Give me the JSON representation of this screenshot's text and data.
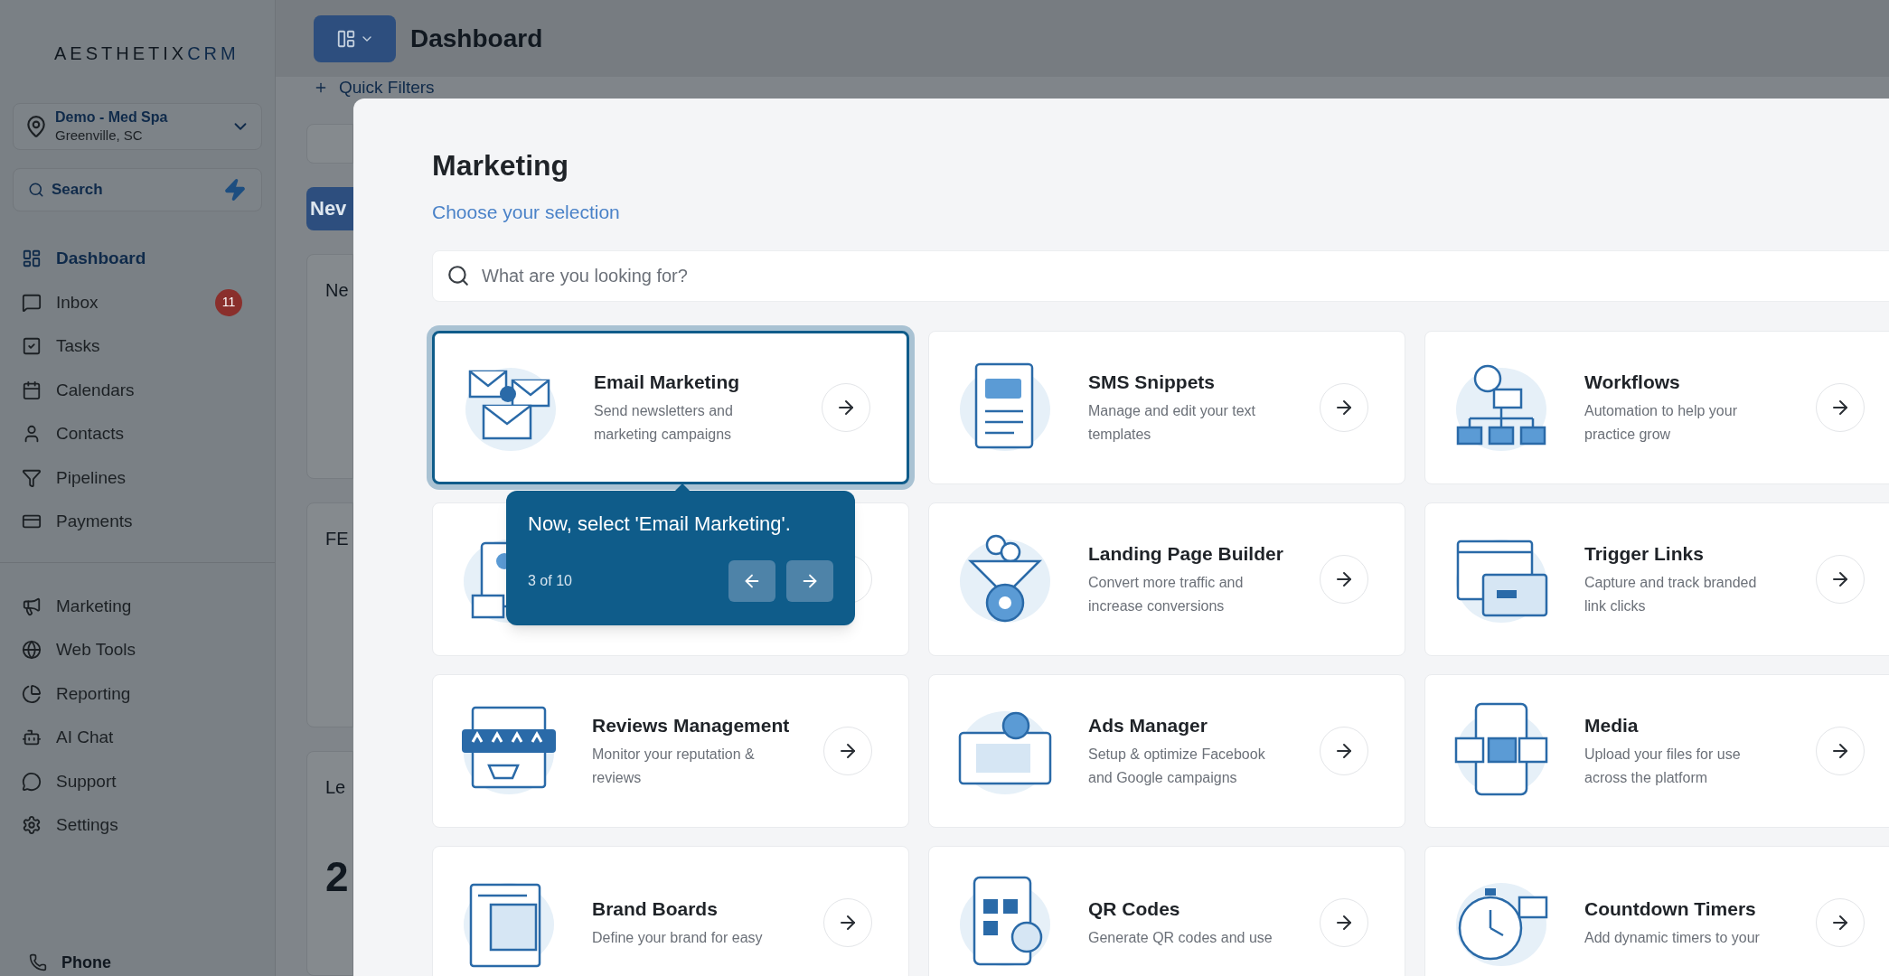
{
  "sidebar": {
    "logo": {
      "text": "AESTHETIX",
      "accent": "CRM"
    },
    "location": {
      "name": "Demo - Med Spa",
      "city": "Greenville, SC"
    },
    "search": {
      "label": "Search"
    },
    "items": [
      {
        "label": "Dashboard",
        "selected": true
      },
      {
        "label": "Inbox",
        "selected": false,
        "badge": "11"
      },
      {
        "label": "Tasks",
        "selected": false
      },
      {
        "label": "Calendars",
        "selected": false
      },
      {
        "label": "Contacts",
        "selected": false
      },
      {
        "label": "Pipelines",
        "selected": false
      },
      {
        "label": "Payments",
        "selected": false
      }
    ],
    "items_2": [
      {
        "label": "Marketing",
        "selected": false
      },
      {
        "label": "Web Tools",
        "selected": false
      },
      {
        "label": "Reporting",
        "selected": false
      },
      {
        "label": "AI Chat",
        "selected": false
      },
      {
        "label": "Support",
        "selected": false
      },
      {
        "label": "Settings",
        "selected": false
      }
    ],
    "phone": "Phone"
  },
  "header": {
    "title": "Dashboard",
    "quick_filters": "Quick Filters"
  },
  "background": {
    "button": "Nev",
    "cards": [
      "Ne",
      "FE",
      "Le"
    ],
    "number": "2"
  },
  "modal": {
    "title": "Marketing",
    "subtitle": "Choose your selection",
    "search": {
      "placeholder": "What are you looking for?"
    },
    "cards": [
      {
        "kind": "email",
        "title": "Email Marketing",
        "description": "Send newsletters and marketing campaigns",
        "selected": true
      },
      {
        "kind": "sms",
        "title": "SMS Snippets",
        "description": "Manage and edit your text templates",
        "selected": false
      },
      {
        "kind": "workflow",
        "title": "Workflows",
        "description": "Automation to help your practice grow",
        "selected": false
      },
      {
        "kind": "contact",
        "selected": false
      },
      {
        "kind": "funnel",
        "title": "Landing Page Builder",
        "description": "Convert more traffic and increase conversions",
        "selected": false
      },
      {
        "kind": "link",
        "title": "Trigger Links",
        "description": "Capture and track branded link clicks",
        "selected": false
      },
      {
        "kind": "reviews",
        "title": "Reviews Management",
        "description": "Monitor your reputation & reviews",
        "selected": false
      },
      {
        "kind": "ads",
        "title": "Ads Manager",
        "description": "Setup & optimize Facebook and Google campaigns",
        "selected": false
      },
      {
        "kind": "media",
        "title": "Media",
        "description": "Upload your files for use across the platform",
        "selected": false
      },
      {
        "kind": "brand",
        "title": "Brand Boards",
        "description": "Define your brand for easy",
        "selected": false
      },
      {
        "kind": "qr",
        "title": "QR Codes",
        "description": "Generate QR codes and use",
        "selected": false
      },
      {
        "kind": "timer",
        "title": "Countdown Timers",
        "description": "Add dynamic timers to your",
        "selected": false
      }
    ]
  },
  "tour": {
    "text": "Now, select 'Email Marketing'.",
    "step": "3 of 10"
  }
}
